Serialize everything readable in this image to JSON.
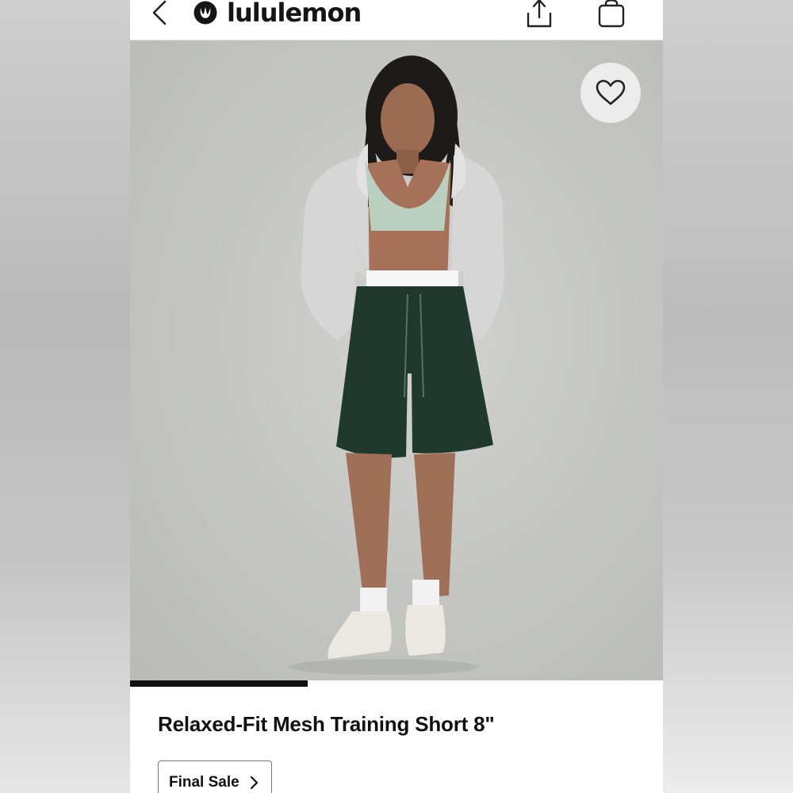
{
  "header": {
    "brand_name": "lululemon",
    "back_icon": "chevron-left-icon",
    "share_icon": "share-icon",
    "bag_icon": "shopping-bag-icon"
  },
  "gallery": {
    "wishlist_icon": "heart-outline-icon",
    "progress_fraction": 0.333
  },
  "product": {
    "title": "Relaxed-Fit Mesh Training Short 8\"",
    "badge_label": "Final Sale",
    "badge_icon": "chevron-right-icon"
  },
  "colors": {
    "accent": "#111111",
    "short_color": "#1f3a2c",
    "bra_color": "#bcd3c4",
    "hoodie_color": "#d9d9d9"
  }
}
